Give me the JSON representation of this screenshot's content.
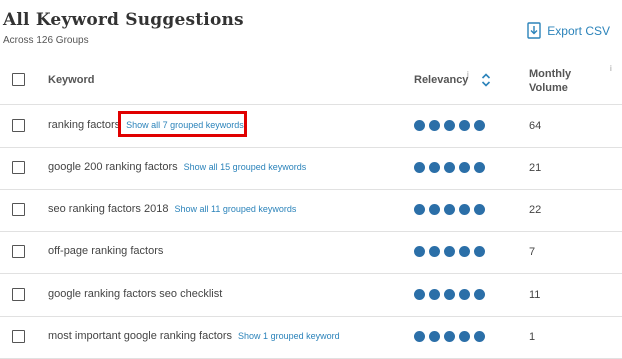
{
  "header": {
    "title": "All Keyword Suggestions",
    "subtitle": "Across 126 Groups",
    "export_label": "Export CSV",
    "accent": "#2b83ba"
  },
  "columns": {
    "keyword": "Keyword",
    "relevancy": "Relevancy",
    "monthly_volume_line1": "Monthly",
    "monthly_volume_line2": "Volume",
    "info_glyph": "i"
  },
  "rows": [
    {
      "keyword": "ranking factors",
      "grouped": "Show all 7 grouped keywords",
      "relevancy": 5,
      "volume": "64"
    },
    {
      "keyword": "google 200 ranking factors",
      "grouped": "Show all 15 grouped keywords",
      "relevancy": 5,
      "volume": "21"
    },
    {
      "keyword": "seo ranking factors 2018",
      "grouped": "Show all 11 grouped keywords",
      "relevancy": 5,
      "volume": "22"
    },
    {
      "keyword": "off-page ranking factors",
      "grouped": "",
      "relevancy": 5,
      "volume": "7"
    },
    {
      "keyword": "google ranking factors seo checklist",
      "grouped": "",
      "relevancy": 5,
      "volume": "11"
    },
    {
      "keyword": "most important google ranking factors",
      "grouped": "Show 1 grouped keyword",
      "relevancy": 5,
      "volume": "1"
    }
  ],
  "colors": {
    "dot": "#2b6fa8",
    "highlight": "#e00000"
  },
  "icons": {
    "export": "download-file-icon",
    "sort": "sort-updown-icon"
  }
}
